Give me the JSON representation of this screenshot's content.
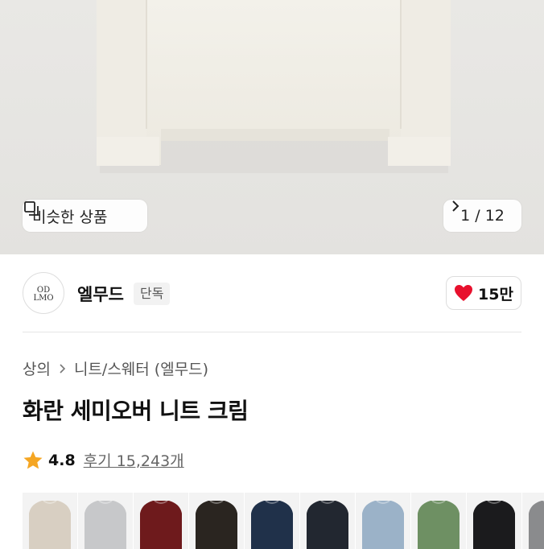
{
  "hero": {
    "similar_label": "비슷한 상품",
    "counter": "1 / 12"
  },
  "brand": {
    "logo_text": "LMOOD",
    "name": "엘무드",
    "exclusive_badge": "단독",
    "likes": "15만"
  },
  "breadcrumb": {
    "category": "상의",
    "subcategory": "니트/스웨터 (엘무드)"
  },
  "product": {
    "title": "화란 세미오버 니트 크림",
    "rating": "4.8",
    "reviews": "후기 15,243개"
  },
  "colors": {
    "like_heart": "#e8102d",
    "star": "#f5a623"
  },
  "swatches": [
    {
      "name": "beige",
      "color": "#d8cfc2"
    },
    {
      "name": "light-gray",
      "color": "#c7c8ca"
    },
    {
      "name": "burgundy",
      "color": "#6e1a1c"
    },
    {
      "name": "black-brown",
      "color": "#2a2520"
    },
    {
      "name": "navy",
      "color": "#20314a"
    },
    {
      "name": "dark-navy",
      "color": "#222730"
    },
    {
      "name": "sky-blue",
      "color": "#9bb2c8"
    },
    {
      "name": "green",
      "color": "#6e9063"
    },
    {
      "name": "black",
      "color": "#1b1b1d"
    },
    {
      "name": "gray",
      "color": "#8a8b8d"
    }
  ]
}
